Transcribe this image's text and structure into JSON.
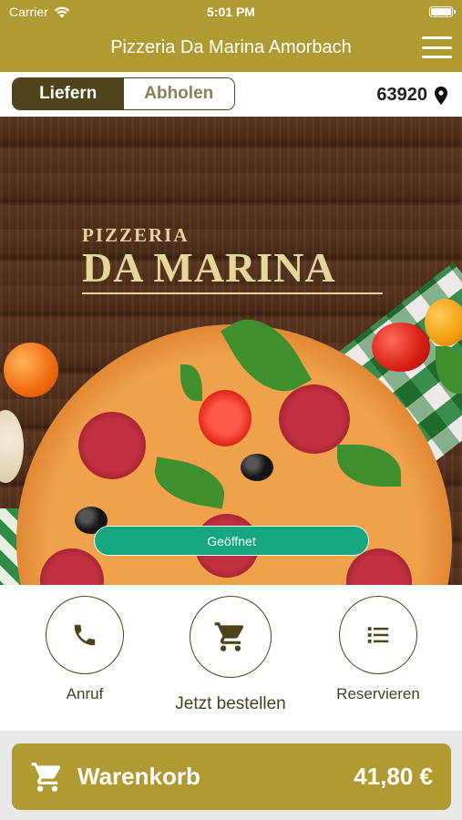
{
  "status_bar": {
    "carrier": "Carrier",
    "time": "5:01 PM"
  },
  "header": {
    "title": "Pizzeria Da Marina Amorbach"
  },
  "delivery_mode": {
    "options": [
      "Liefern",
      "Abholen"
    ],
    "selected": "Liefern"
  },
  "location": {
    "zip": "63920"
  },
  "hero": {
    "brand_line1": "PIZZERIA",
    "brand_line2": "DA MARINA",
    "status_label": "Geöffnet"
  },
  "actions": [
    {
      "label": "Anruf",
      "icon": "phone-icon"
    },
    {
      "label": "Jetzt bestellen",
      "icon": "cart-icon"
    },
    {
      "label": "Reservieren",
      "icon": "list-icon"
    }
  ],
  "cart": {
    "label": "Warenkorb",
    "total": "41,80 €"
  },
  "colors": {
    "accent": "#b29a32",
    "dark": "#4f4319",
    "open": "#16a77f"
  }
}
